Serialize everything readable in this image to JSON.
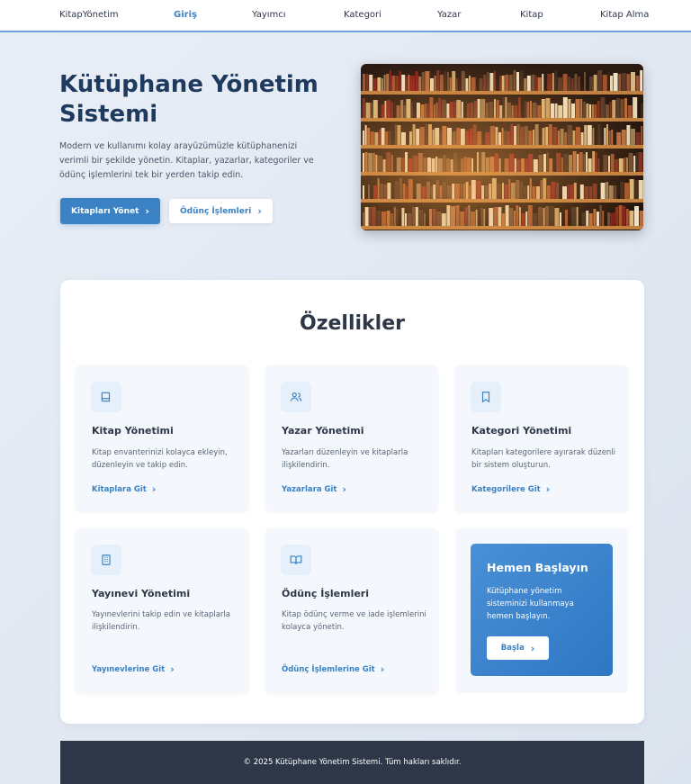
{
  "nav": {
    "items": [
      {
        "label": "KitapYönetim"
      },
      {
        "label": "Giriş"
      },
      {
        "label": "Yayımcı"
      },
      {
        "label": "Kategori"
      },
      {
        "label": "Yazar"
      },
      {
        "label": "Kitap"
      },
      {
        "label": "Kitap Alma"
      }
    ],
    "active_index": 1
  },
  "hero": {
    "title": "Kütüphane Yönetim Sistemi",
    "description": "Modern ve kullanımı kolay arayüzümüzle kütüphanenizi verimli bir şekilde yönetin. Kitaplar, yazarlar, kategoriler ve ödünç işlemlerini tek bir yerden takip edin.",
    "primary_button": "Kitapları Yönet",
    "secondary_button": "Ödünç İşlemleri"
  },
  "features": {
    "title": "Özellikler",
    "cards": [
      {
        "icon": "book-icon",
        "title": "Kitap Yönetimi",
        "description": "Kitap envanterinizi kolayca ekleyin, düzenleyin ve takip edin.",
        "link": "Kitaplara Git"
      },
      {
        "icon": "users-icon",
        "title": "Yazar Yönetimi",
        "description": "Yazarları düzenleyin ve kitaplarla ilişkilendirin.",
        "link": "Yazarlara Git"
      },
      {
        "icon": "bookmark-icon",
        "title": "Kategori Yönetimi",
        "description": "Kitapları kategorilere ayırarak düzenli bir sistem oluşturun.",
        "link": "Kategorilere Git"
      },
      {
        "icon": "building-icon",
        "title": "Yayınevi Yönetimi",
        "description": "Yayınevlerini takip edin ve kitaplarla ilişkilendirin.",
        "link": "Yayınevlerine Git"
      },
      {
        "icon": "open-book-icon",
        "title": "Ödünç İşlemleri",
        "description": "Kitap ödünç verme ve iade işlemlerini kolayca yönetin.",
        "link": "Ödünç İşlemlerine Git"
      }
    ],
    "cta": {
      "title": "Hemen Başlayın",
      "description": "Kütüphane yönetim sisteminizi kullanmaya hemen başlayın.",
      "button": "Başla"
    }
  },
  "footer": {
    "text": "© 2025 Kütüphane Yönetim Sistemi. Tüm hakları saklıdır."
  },
  "colors": {
    "accent": "#3b82c4",
    "title": "#1f3a5f",
    "footer_bg": "#2d3748"
  }
}
